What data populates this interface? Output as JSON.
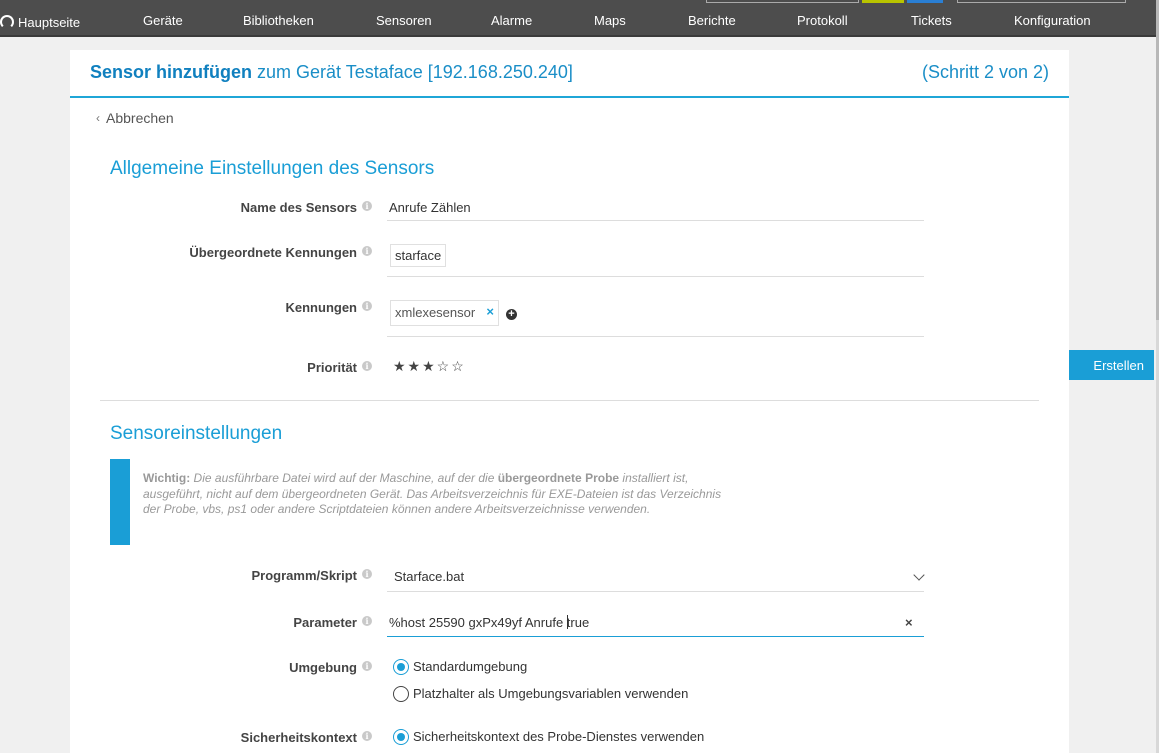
{
  "nav": {
    "home": "Hauptseite",
    "items": [
      "Geräte",
      "Bibliotheken",
      "Sensoren",
      "Alarme",
      "Maps",
      "Berichte",
      "Protokoll",
      "Tickets",
      "Konfiguration"
    ]
  },
  "header": {
    "title_strong": "Sensor hinzufügen",
    "title_rest": "zum Gerät Testaface [192.168.250.240]",
    "step": "(Schritt 2 von 2)"
  },
  "cancel_label": "Abbrechen",
  "general": {
    "section_title": "Allgemeine Einstellungen des Sensors",
    "sensor_name_label": "Name des Sensors",
    "sensor_name_value": "Anrufe Zählen",
    "parent_tags_label": "Übergeordnete Kennungen",
    "parent_tag": "starface",
    "tags_label": "Kennungen",
    "tag": "xmlexesensor",
    "tag_remove": "×",
    "add_tag": "+",
    "priority_label": "Priorität",
    "priority_filled": "★★★",
    "priority_empty": "☆☆",
    "priority_value": 3,
    "priority_max": 5
  },
  "sensor": {
    "section_title": "Sensoreinstellungen",
    "note_prefix": "Wichtig:",
    "note_part1": " Die ausführbare Datei wird auf der Maschine, auf der die ",
    "note_bold": "übergeordnete Probe",
    "note_part2": " installiert ist, ausgeführt, nicht auf dem übergeordneten Gerät. Das Arbeitsverzeichnis für EXE-Dateien ist das Verzeichnis der Probe, vbs, ps1 oder andere Scriptdateien können andere Arbeitsverzeichnisse verwenden.",
    "program_label": "Programm/Skript",
    "program_value": "Starface.bat",
    "parameter_label": "Parameter",
    "parameter_before_caret": "%host 25590 gxPx49yf Anrufe ",
    "parameter_after_caret": "true",
    "parameter_clear": "×",
    "environment_label": "Umgebung",
    "env_option_1": "Standardumgebung",
    "env_option_2": "Platzhalter als Umgebungsvariablen verwenden",
    "security_label": "Sicherheitskontext",
    "security_option_1": "Sicherheitskontext des Probe-Dienstes verwenden"
  },
  "create_button": "Erstellen",
  "info_glyph": "i",
  "colors": {
    "accent": "#1a9ed6",
    "nav_bg": "#4d4d4d",
    "nav_box_yellow": "#b8c400",
    "nav_box_blue": "#2a7fd4"
  }
}
